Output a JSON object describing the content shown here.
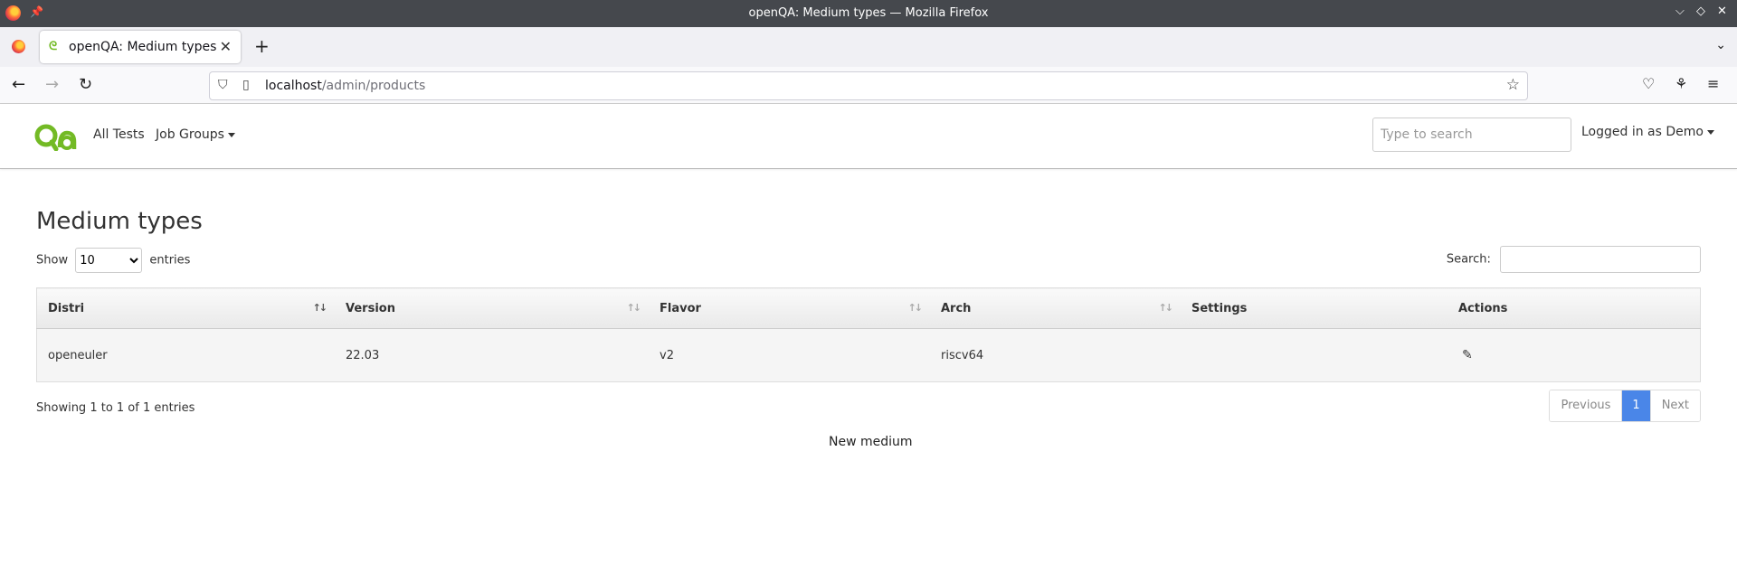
{
  "window": {
    "title": "openQA: Medium types — Mozilla Firefox"
  },
  "tabs": [
    {
      "label": "openQA: Medium types"
    }
  ],
  "navbar": {
    "url_host": "localhost",
    "url_path": "/admin/products"
  },
  "header": {
    "links": [
      "All Tests",
      "Job Groups"
    ],
    "search_placeholder": "Type to search",
    "user": "Logged in as Demo"
  },
  "page": {
    "title": "Medium types",
    "length_prefix": "Show",
    "length_value": "10",
    "length_suffix": "entries",
    "search_label": "Search:",
    "columns": [
      "Distri",
      "Version",
      "Flavor",
      "Arch",
      "Settings",
      "Actions"
    ],
    "rows": [
      {
        "distri": "openeuler",
        "version": "22.03",
        "flavor": "v2",
        "arch": "riscv64",
        "settings": ""
      }
    ],
    "info": "Showing 1 to 1 of 1 entries",
    "pager": {
      "previous": "Previous",
      "current": "1",
      "next": "Next"
    },
    "new_medium": "New medium"
  },
  "colors": {
    "accent": "#4a86e8",
    "brand": "#73ba25",
    "titlebar": "#45484d"
  }
}
